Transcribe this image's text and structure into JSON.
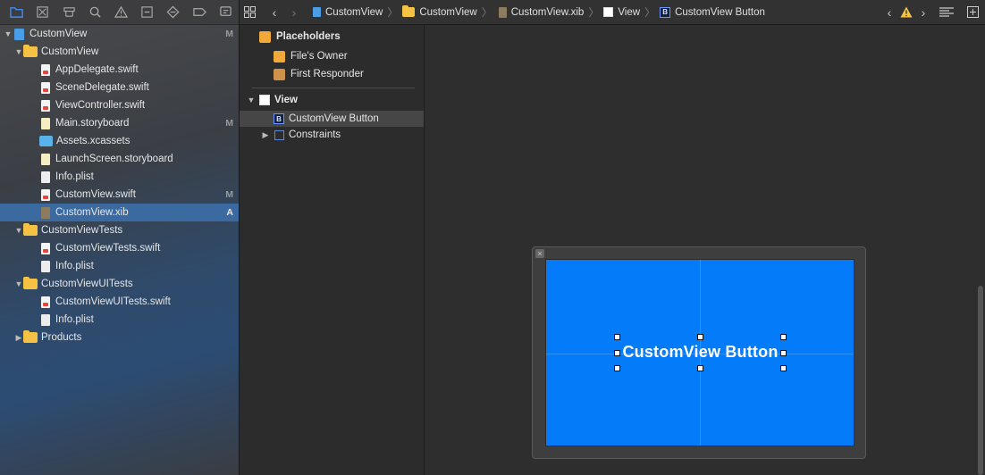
{
  "navigator": {
    "toolbar_icons": [
      "folder-icon",
      "source-control-icon",
      "symbol-icon",
      "find-icon",
      "issue-icon",
      "test-icon",
      "debug-icon",
      "breakpoint-icon",
      "report-icon"
    ],
    "items": [
      {
        "label": "CustomView",
        "kind": "project",
        "indent": 0,
        "expanded": true,
        "badge": "M"
      },
      {
        "label": "CustomView",
        "kind": "folder",
        "indent": 1,
        "expanded": true,
        "badge": ""
      },
      {
        "label": "AppDelegate.swift",
        "kind": "swift",
        "indent": 2,
        "badge": ""
      },
      {
        "label": "SceneDelegate.swift",
        "kind": "swift",
        "indent": 2,
        "badge": ""
      },
      {
        "label": "ViewController.swift",
        "kind": "swift",
        "indent": 2,
        "badge": ""
      },
      {
        "label": "Main.storyboard",
        "kind": "storyboard",
        "indent": 2,
        "badge": "M"
      },
      {
        "label": "Assets.xcassets",
        "kind": "assets",
        "indent": 2,
        "badge": ""
      },
      {
        "label": "LaunchScreen.storyboard",
        "kind": "storyboard",
        "indent": 2,
        "badge": ""
      },
      {
        "label": "Info.plist",
        "kind": "plist",
        "indent": 2,
        "badge": ""
      },
      {
        "label": "CustomView.swift",
        "kind": "swift",
        "indent": 2,
        "badge": "M"
      },
      {
        "label": "CustomView.xib",
        "kind": "xib",
        "indent": 2,
        "badge": "A",
        "selected": true
      },
      {
        "label": "CustomViewTests",
        "kind": "folder",
        "indent": 1,
        "expanded": true,
        "badge": ""
      },
      {
        "label": "CustomViewTests.swift",
        "kind": "swift",
        "indent": 2,
        "badge": ""
      },
      {
        "label": "Info.plist",
        "kind": "plist",
        "indent": 2,
        "badge": ""
      },
      {
        "label": "CustomViewUITests",
        "kind": "folder",
        "indent": 1,
        "expanded": true,
        "badge": ""
      },
      {
        "label": "CustomViewUITests.swift",
        "kind": "swift",
        "indent": 2,
        "badge": ""
      },
      {
        "label": "Info.plist",
        "kind": "plist",
        "indent": 2,
        "badge": ""
      },
      {
        "label": "Products",
        "kind": "folder",
        "indent": 1,
        "expanded": false,
        "badge": ""
      }
    ]
  },
  "jumpbar": {
    "crumbs": [
      {
        "label": "CustomView",
        "icon": "project-file-icon"
      },
      {
        "label": "CustomView",
        "icon": "folder-icon"
      },
      {
        "label": "CustomView.xib",
        "icon": "xib-file-icon"
      },
      {
        "label": "View",
        "icon": "view-icon"
      },
      {
        "label": "CustomView Button",
        "icon": "button-b-icon"
      }
    ],
    "warning_icon": "warning-icon"
  },
  "outline": {
    "placeholders_label": "Placeholders",
    "files_owner": "File's Owner",
    "first_responder": "First Responder",
    "view_label": "View",
    "button_label": "CustomView Button",
    "constraints_label": "Constraints"
  },
  "canvas": {
    "button_title": "CustomView Button",
    "view_color": "#047bf8"
  }
}
